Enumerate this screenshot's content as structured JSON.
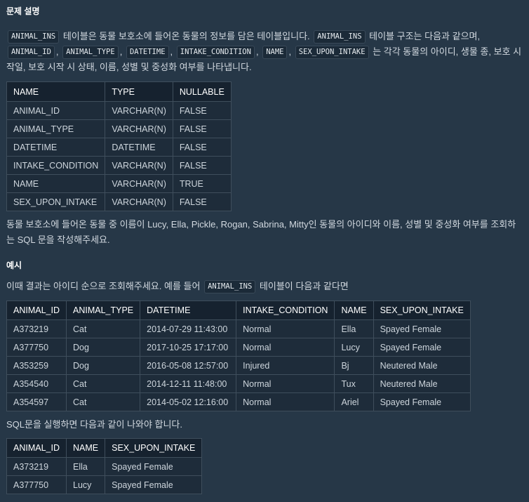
{
  "section_titles": {
    "description": "문제 설명",
    "example": "예시"
  },
  "description": {
    "code_animal_ins": "ANIMAL_INS",
    "text1": "테이블은 동물 보호소에 들어온 동물의 정보를 담은 테이블입니다.",
    "text2": "테이블 구조는 다음과 같으며,",
    "codes": [
      "ANIMAL_ID",
      "ANIMAL_TYPE",
      "DATETIME",
      "INTAKE_CONDITION",
      "NAME",
      "SEX_UPON_INTAKE"
    ],
    "comma": ",",
    "text3": "는 각각 동물의 아이디, 생물 종, 보호 시작일, 보호 시작 시 상태, 이름, 성별 및 중성화 여부를 나타냅니다."
  },
  "schema_table": {
    "headers": [
      "NAME",
      "TYPE",
      "NULLABLE"
    ],
    "rows": [
      [
        "ANIMAL_ID",
        "VARCHAR(N)",
        "FALSE"
      ],
      [
        "ANIMAL_TYPE",
        "VARCHAR(N)",
        "FALSE"
      ],
      [
        "DATETIME",
        "DATETIME",
        "FALSE"
      ],
      [
        "INTAKE_CONDITION",
        "VARCHAR(N)",
        "FALSE"
      ],
      [
        "NAME",
        "VARCHAR(N)",
        "TRUE"
      ],
      [
        "SEX_UPON_INTAKE",
        "VARCHAR(N)",
        "FALSE"
      ]
    ]
  },
  "question": "동물 보호소에 들어온 동물 중 이름이 Lucy, Ella, Pickle, Rogan, Sabrina, Mitty인 동물의 아이디와 이름, 성별 및 중성화 여부를 조회하는 SQL 문을 작성해주세요.",
  "example": {
    "intro_before": "이때 결과는 아이디 순으로 조회해주세요. 예를 들어",
    "intro_code": "ANIMAL_INS",
    "intro_after": "테이블이 다음과 같다면",
    "input_table": {
      "headers": [
        "ANIMAL_ID",
        "ANIMAL_TYPE",
        "DATETIME",
        "INTAKE_CONDITION",
        "NAME",
        "SEX_UPON_INTAKE"
      ],
      "rows": [
        [
          "A373219",
          "Cat",
          "2014-07-29 11:43:00",
          "Normal",
          "Ella",
          "Spayed Female"
        ],
        [
          "A377750",
          "Dog",
          "2017-10-25 17:17:00",
          "Normal",
          "Lucy",
          "Spayed Female"
        ],
        [
          "A353259",
          "Dog",
          "2016-05-08 12:57:00",
          "Injured",
          "Bj",
          "Neutered Male"
        ],
        [
          "A354540",
          "Cat",
          "2014-12-11 11:48:00",
          "Normal",
          "Tux",
          "Neutered Male"
        ],
        [
          "A354597",
          "Cat",
          "2014-05-02 12:16:00",
          "Normal",
          "Ariel",
          "Spayed Female"
        ]
      ]
    },
    "result_intro": "SQL문을 실행하면 다음과 같이 나와야 합니다.",
    "result_table": {
      "headers": [
        "ANIMAL_ID",
        "NAME",
        "SEX_UPON_INTAKE"
      ],
      "rows": [
        [
          "A373219",
          "Ella",
          "Spayed Female"
        ],
        [
          "A377750",
          "Lucy",
          "Spayed Female"
        ]
      ]
    }
  }
}
